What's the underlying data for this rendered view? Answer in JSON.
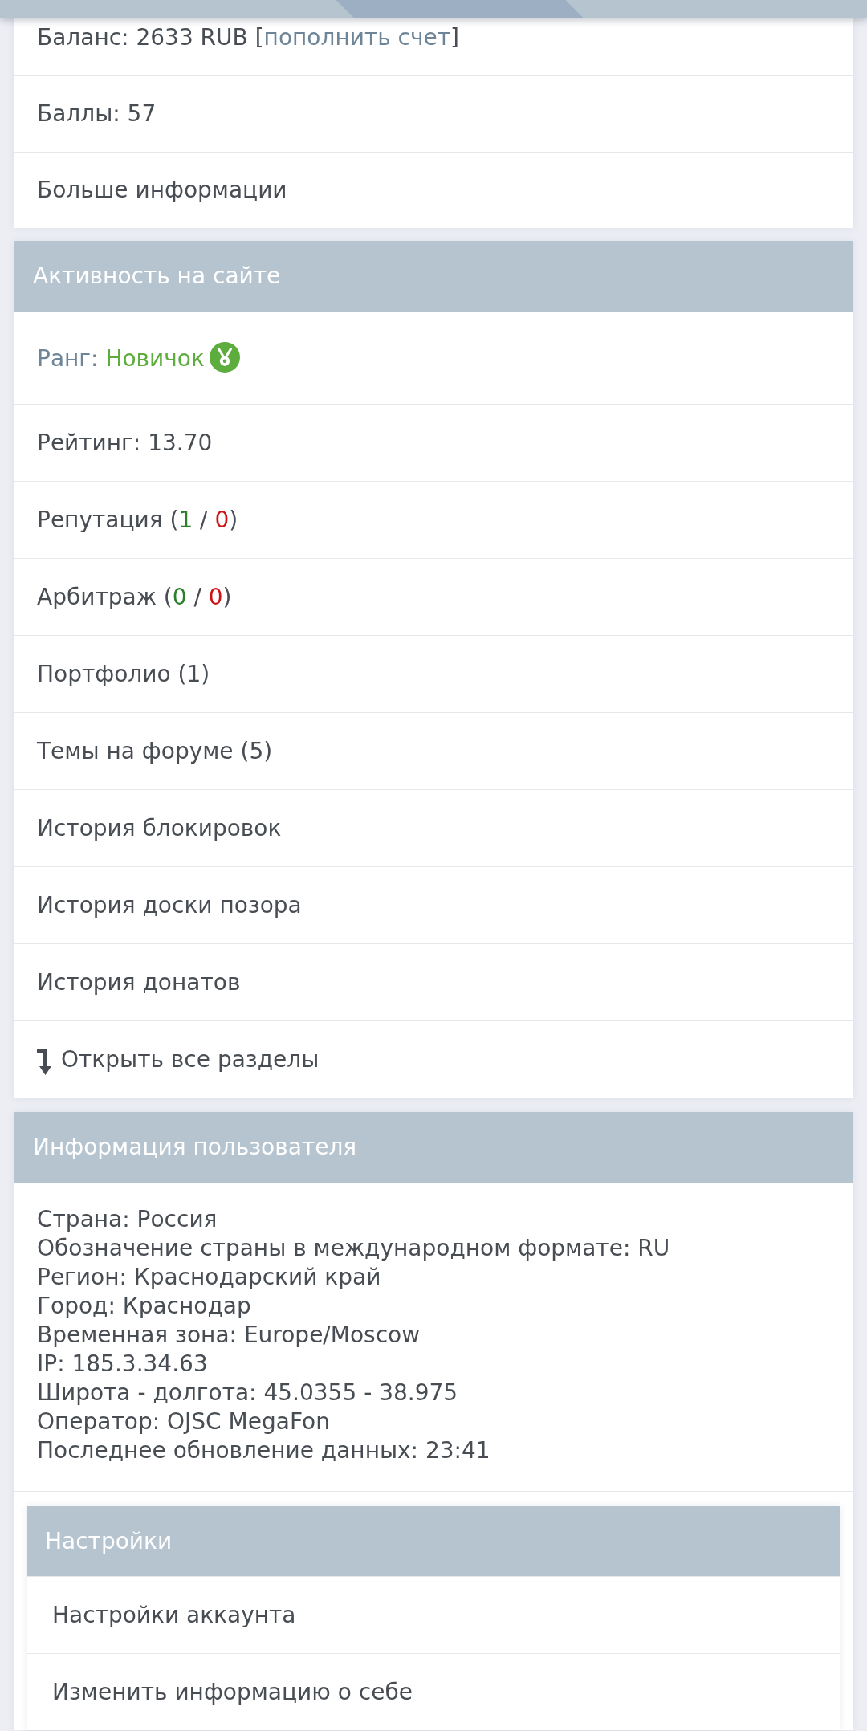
{
  "account": {
    "rows": [
      {
        "kind": "plain",
        "parts": [
          {
            "kind": "plain",
            "text": "Баланс: 2633 RUB ["
          },
          {
            "kind": "link",
            "text": "пополнить счет"
          },
          {
            "kind": "plain",
            "text": "]"
          }
        ]
      },
      {
        "kind": "plain",
        "parts": [
          {
            "kind": "plain",
            "text": "Баллы: 57"
          }
        ]
      },
      {
        "kind": "plain",
        "parts": [
          {
            "kind": "plain",
            "text": "Больше информации"
          }
        ]
      }
    ]
  },
  "activity": {
    "title": "Активность на сайте",
    "rows": [
      {
        "kind": "rank",
        "parts": [
          {
            "kind": "muted",
            "text": "Ранг: "
          },
          {
            "kind": "rank",
            "text": "Новичок"
          }
        ]
      },
      {
        "kind": "plain",
        "parts": [
          {
            "kind": "plain",
            "text": "Рейтинг: 13.70"
          }
        ]
      },
      {
        "kind": "plain",
        "parts": [
          {
            "kind": "plain",
            "text": "Репутация ("
          },
          {
            "kind": "positive",
            "text": "1"
          },
          {
            "kind": "plain",
            "text": " / "
          },
          {
            "kind": "negative",
            "text": "0"
          },
          {
            "kind": "plain",
            "text": ")"
          }
        ]
      },
      {
        "kind": "plain",
        "parts": [
          {
            "kind": "plain",
            "text": "Арбитраж ("
          },
          {
            "kind": "positive",
            "text": "0"
          },
          {
            "kind": "plain",
            "text": " / "
          },
          {
            "kind": "negative",
            "text": "0"
          },
          {
            "kind": "plain",
            "text": ")"
          }
        ]
      },
      {
        "kind": "plain",
        "parts": [
          {
            "kind": "plain",
            "text": "Портфолио (1)"
          }
        ]
      },
      {
        "kind": "plain",
        "parts": [
          {
            "kind": "plain",
            "text": "Темы на форуме (5)"
          }
        ]
      },
      {
        "kind": "plain",
        "parts": [
          {
            "kind": "plain",
            "text": "История блокировок"
          }
        ]
      },
      {
        "kind": "plain",
        "parts": [
          {
            "kind": "plain",
            "text": "История доски позора"
          }
        ]
      },
      {
        "kind": "plain",
        "parts": [
          {
            "kind": "plain",
            "text": "История донатов"
          }
        ]
      },
      {
        "kind": "expand",
        "parts": [
          {
            "kind": "plain",
            "text": "Открыть все разделы"
          }
        ]
      }
    ]
  },
  "user_info": {
    "title": "Информация пользователя",
    "lines": [
      "Страна: Россия",
      "Обозначение страны в международном формате: RU",
      "Регион: Краснодарский край",
      "Город: Краснодар",
      "Временная зона: Europe/Moscow",
      "IP: 185.3.34.63",
      "Широта - долгота: 45.0355 - 38.975",
      "Оператор: OJSC MegaFon",
      "Последнее обновление данных: 23:41"
    ],
    "settings": {
      "title": "Настройки",
      "items": [
        "Настройки аккаунта",
        "Изменить информацию о себе"
      ]
    }
  }
}
